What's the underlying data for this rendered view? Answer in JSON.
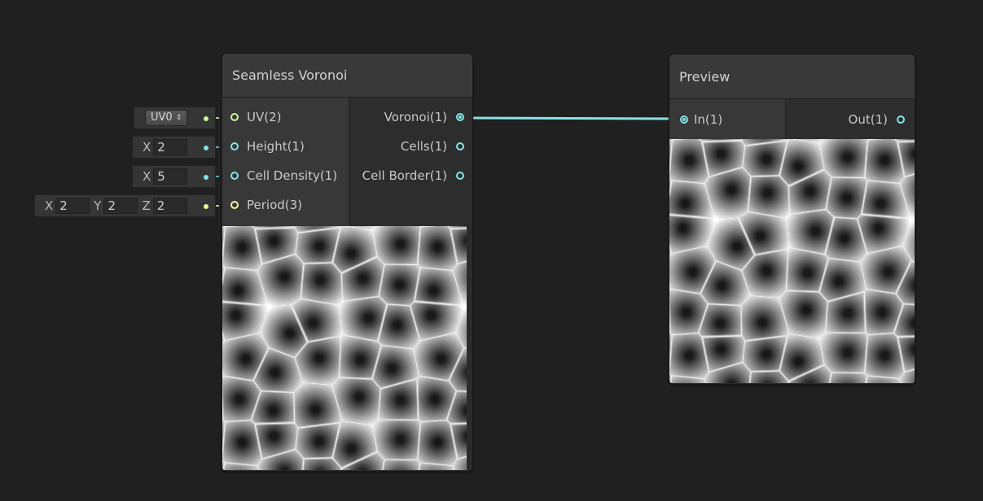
{
  "colors": {
    "background": "#202020",
    "wire_vector": "#84e4e7",
    "port_uv": "#cdf59b",
    "port_vector3": "#f1f89a"
  },
  "voronoi_node": {
    "title": "Seamless Voronoi",
    "inputs": [
      {
        "label": "UV(2)",
        "type": "vector2"
      },
      {
        "label": "Height(1)",
        "type": "vector1"
      },
      {
        "label": "Cell Density(1)",
        "type": "vector1"
      },
      {
        "label": "Period(3)",
        "type": "vector3"
      }
    ],
    "outputs": [
      {
        "label": "Voronoi(1)",
        "connected": true
      },
      {
        "label": "Cells(1)",
        "connected": false
      },
      {
        "label": "Cell Border(1)",
        "connected": false
      }
    ]
  },
  "preview_node": {
    "title": "Preview",
    "input": {
      "label": "In(1)",
      "connected": true
    },
    "output": {
      "label": "Out(1)",
      "connected": false
    }
  },
  "defaults": {
    "uv_channel": "UV0",
    "height": {
      "axis": "X",
      "value": "2"
    },
    "cell_density": {
      "axis": "X",
      "value": "5"
    },
    "period": {
      "x_axis": "X",
      "x": "2",
      "y_axis": "Y",
      "y": "2",
      "z_axis": "Z",
      "z": "2"
    }
  }
}
